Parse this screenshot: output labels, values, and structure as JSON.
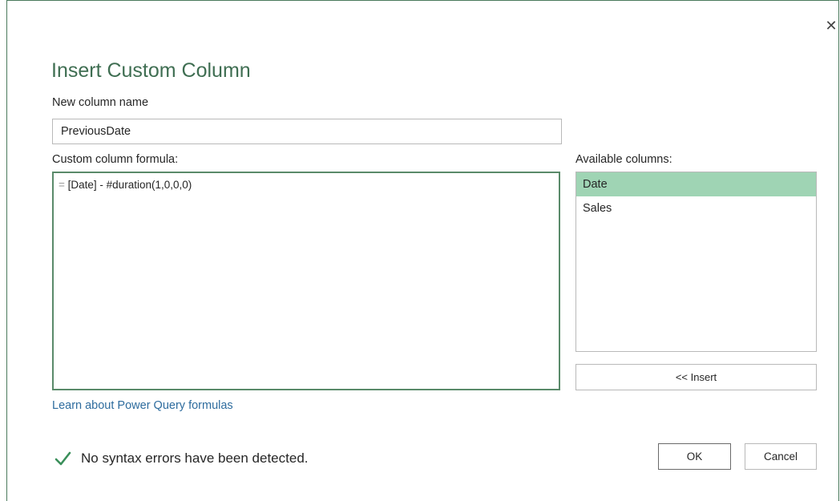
{
  "dialog": {
    "close_glyph": "✕",
    "title": "Insert Custom Column",
    "new_column_name_label": "New column name",
    "new_column_name_value": "PreviousDate",
    "formula_label": "Custom column formula:",
    "formula_prefix": "=",
    "formula_value": "[Date] - #duration(1,0,0,0)",
    "available_columns_label": "Available columns:",
    "available_columns": [
      {
        "label": "Date",
        "selected": true
      },
      {
        "label": "Sales",
        "selected": false
      }
    ],
    "insert_button_label": "<< Insert",
    "learn_link_label": "Learn about Power Query formulas",
    "status_icon": "check-icon",
    "status_text": "No syntax errors have been detected.",
    "ok_button_label": "OK",
    "cancel_button_label": "Cancel"
  },
  "colors": {
    "title": "#3f6e52",
    "accent_border": "#5a8a6a",
    "selected_row": "#9fd4b4",
    "link": "#2e6c9e",
    "check": "#3a8f5a"
  }
}
